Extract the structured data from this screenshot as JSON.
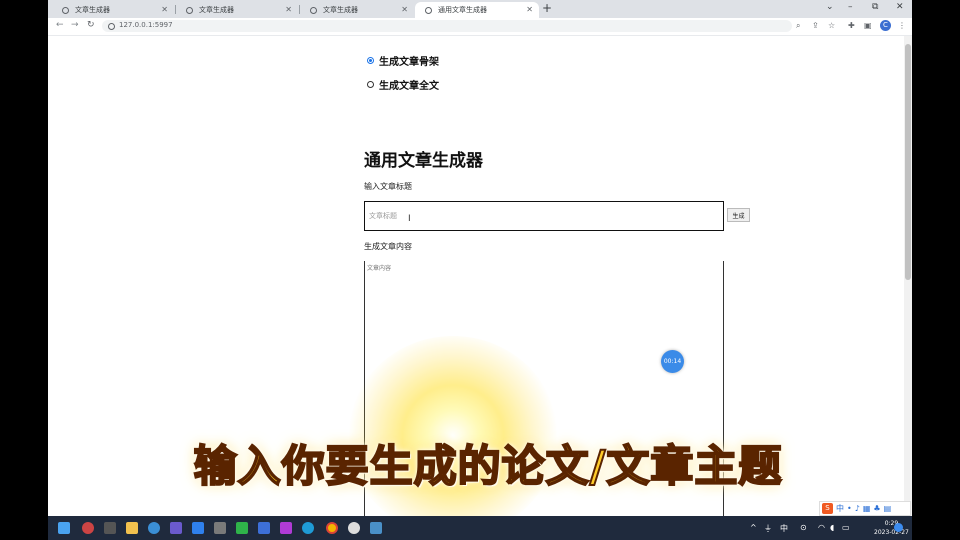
{
  "browser": {
    "tabs": [
      {
        "title": "文章生成器",
        "active": false
      },
      {
        "title": "文章生成器",
        "active": false
      },
      {
        "title": "文章生成器",
        "active": false
      },
      {
        "title": "通用文章生成器",
        "active": true
      }
    ],
    "url": "127.0.0.1:5997",
    "profile_initial": "C"
  },
  "page": {
    "options": [
      {
        "label": "生成文章骨架",
        "checked": true
      },
      {
        "label": "生成文章全文",
        "checked": false
      }
    ],
    "title": "通用文章生成器",
    "title_field_label": "输入文章标题",
    "title_placeholder": "文章标题",
    "generate_button": "生成",
    "content_label": "生成文章内容",
    "content_placeholder": "文章内容"
  },
  "overlay": {
    "timer": "00:14",
    "caption": "输入你要生成的论文/文章主题"
  },
  "ime": {
    "lang": "中"
  },
  "taskbar": {
    "tray_lang": "中",
    "time": "0:29",
    "date": "2023-02-27"
  },
  "colors": {
    "accent": "#1a73e8",
    "taskbar": "#1f2a3d",
    "caption_fill": "#ffcc2a"
  }
}
